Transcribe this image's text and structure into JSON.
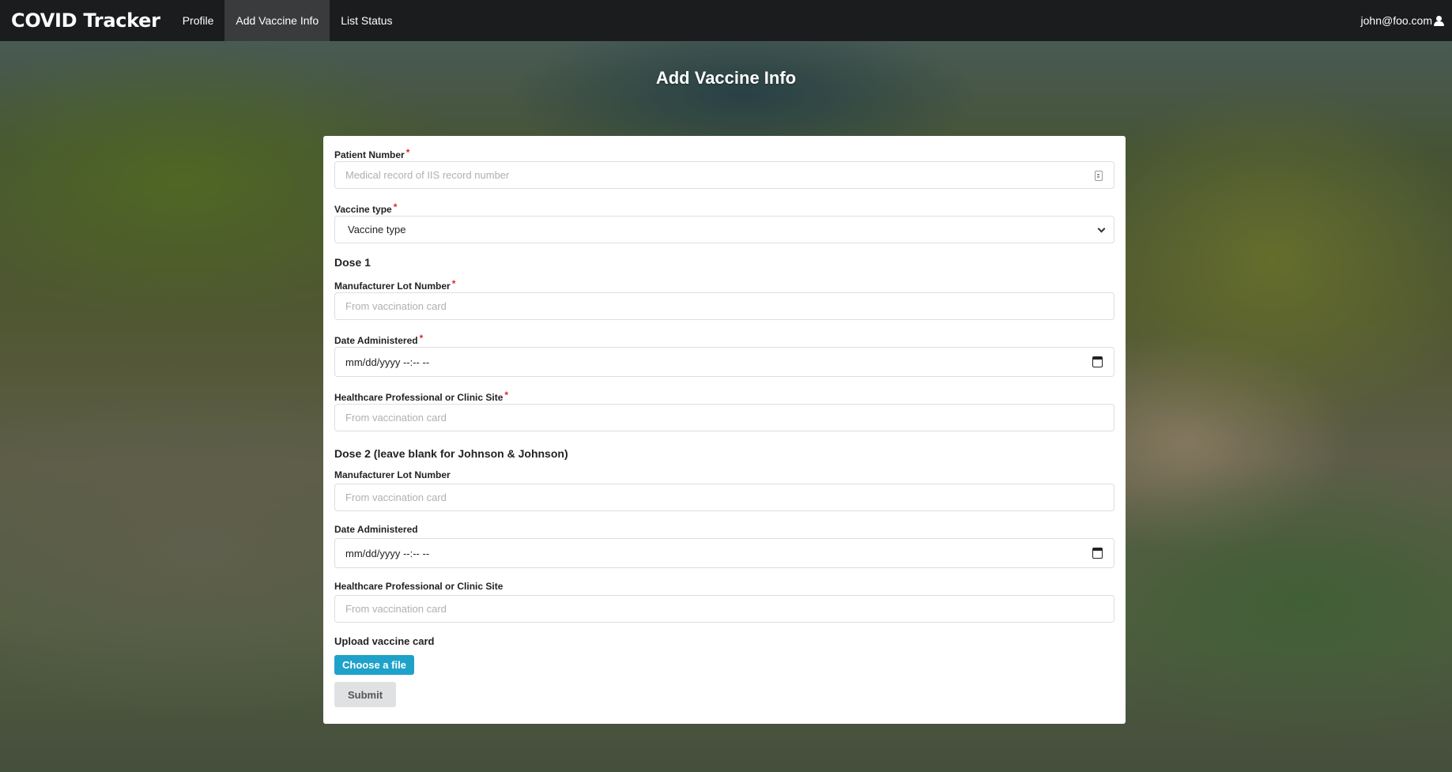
{
  "nav": {
    "brand": "COVID Tracker",
    "items": [
      {
        "label": "Profile",
        "active": false
      },
      {
        "label": "Add Vaccine Info",
        "active": true
      },
      {
        "label": "List Status",
        "active": false
      }
    ],
    "user_email": "john@foo.com"
  },
  "page": {
    "title": "Add Vaccine Info"
  },
  "form": {
    "patient_number": {
      "label": "Patient Number",
      "required_mark": "*",
      "placeholder": "Medical record of IIS record number"
    },
    "vaccine_type": {
      "label": "Vaccine type",
      "required_mark": "*",
      "selected": "Vaccine type"
    },
    "dose1": {
      "title": "Dose 1",
      "lot_number": {
        "label": "Manufacturer Lot Number",
        "required_mark": "*",
        "placeholder": "From vaccination card"
      },
      "date": {
        "label": "Date Administered",
        "required_mark": "*",
        "value": "mm/dd/yyyy --:-- --"
      },
      "site": {
        "label": "Healthcare Professional or Clinic Site",
        "required_mark": "*",
        "placeholder": "From vaccination card"
      }
    },
    "dose2": {
      "title": "Dose 2 (leave blank for Johnson & Johnson)",
      "lot_number": {
        "label": "Manufacturer Lot Number",
        "placeholder": "From vaccination card"
      },
      "date": {
        "label": "Date Administered",
        "value": "mm/dd/yyyy --:-- --"
      },
      "site": {
        "label": "Healthcare Professional or Clinic Site",
        "placeholder": "From vaccination card"
      }
    },
    "upload": {
      "label": "Upload vaccine card",
      "button": "Choose a file"
    },
    "submit_label": "Submit"
  },
  "colors": {
    "navbar": "#1b1c1d",
    "nav_active": "#3a3b3c",
    "required": "#db2828",
    "file_button": "#1fa2c9",
    "submit_button": "#e0e1e2"
  },
  "icons": {
    "patient_field": "id-card-icon",
    "vaccine_select": "chevron-down-icon",
    "date_fields": "calendar-icon",
    "user": "user-icon"
  }
}
